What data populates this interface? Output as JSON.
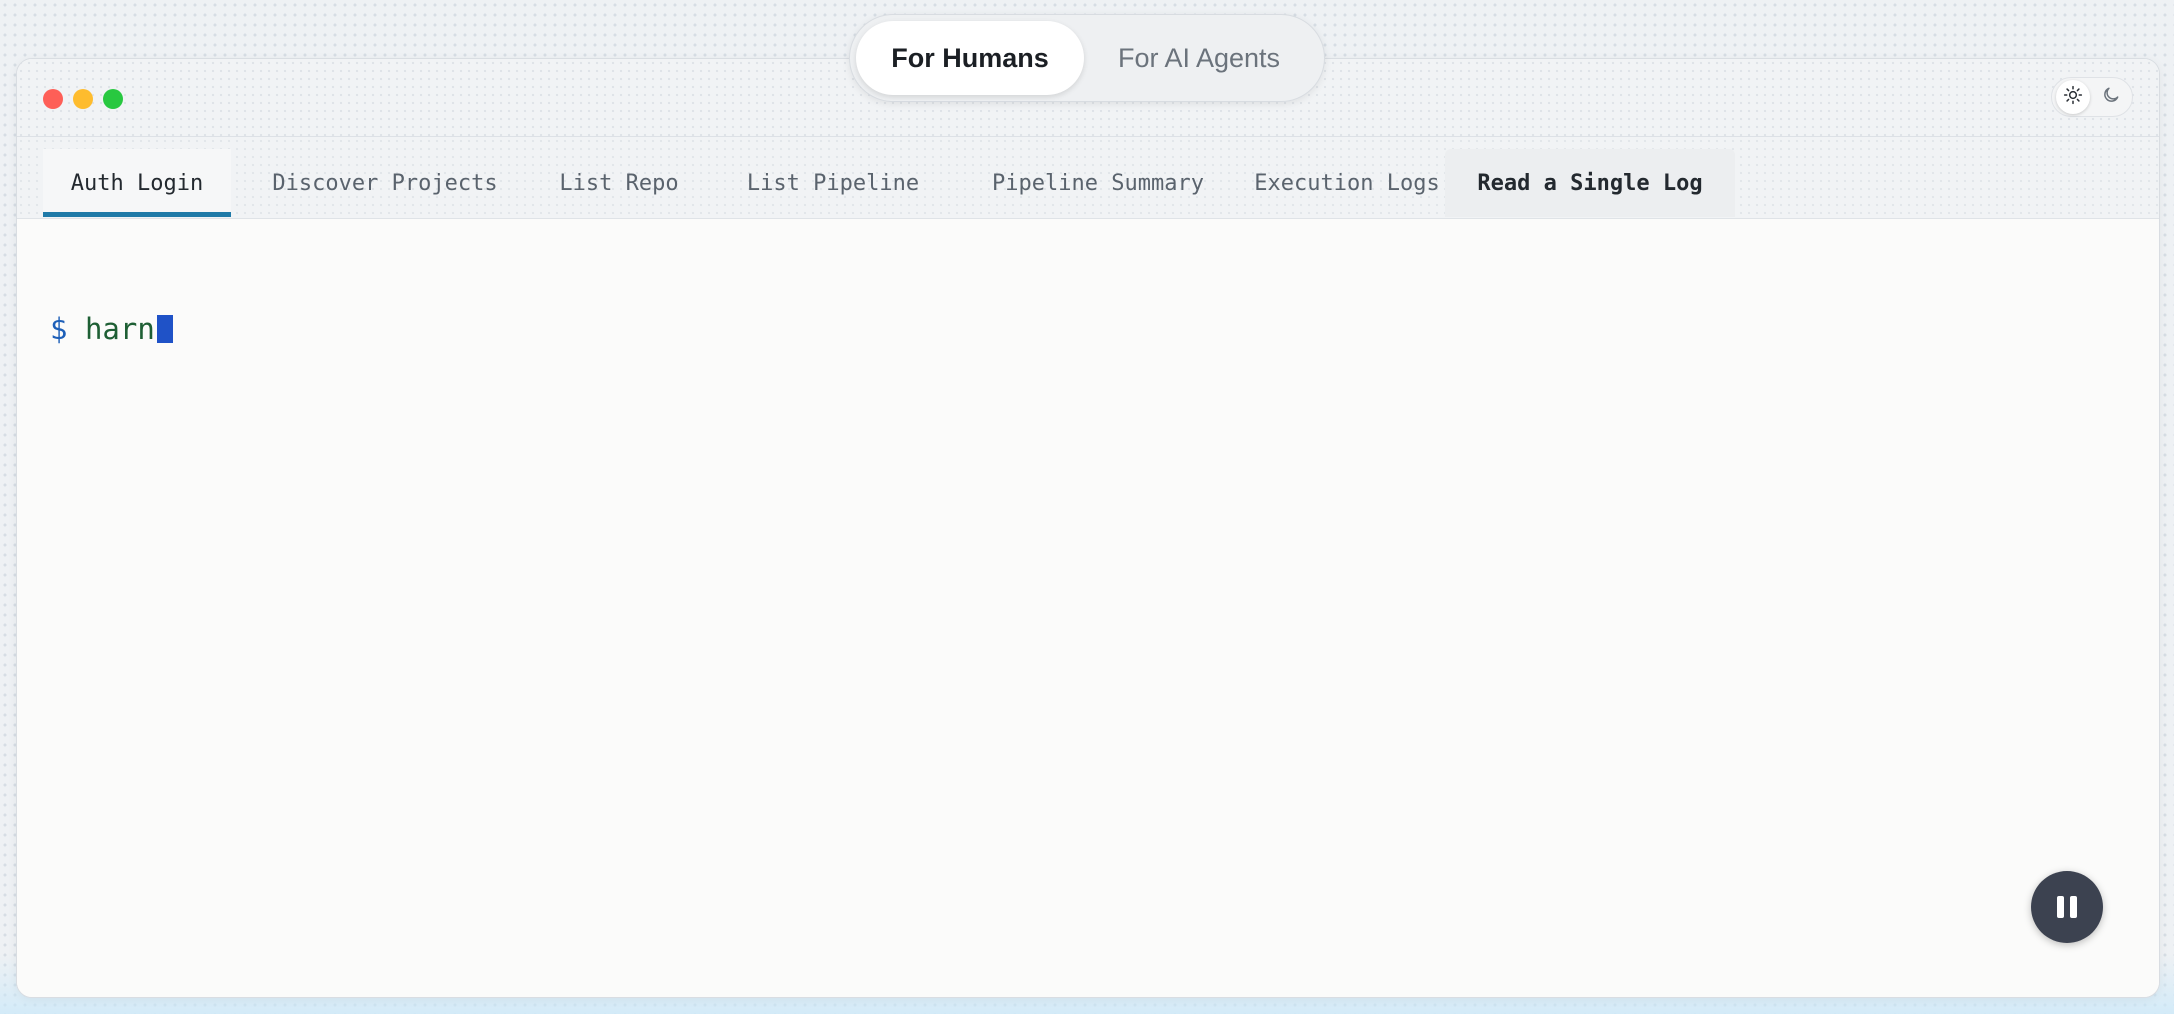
{
  "mode_switch": {
    "options": [
      {
        "label": "For Humans",
        "active": true
      },
      {
        "label": "For AI Agents",
        "active": false
      }
    ]
  },
  "window": {
    "traffic_lights": [
      "close",
      "minimize",
      "maximize"
    ],
    "theme_toggle": {
      "options": [
        "sun-icon",
        "moon-icon"
      ],
      "active": "sun-icon"
    }
  },
  "tabs": [
    {
      "label": "Auth Login",
      "active": true
    },
    {
      "label": "Discover Projects",
      "active": false
    },
    {
      "label": "List Repo",
      "active": false
    },
    {
      "label": "List Pipeline",
      "active": false
    },
    {
      "label": "Pipeline Summary",
      "active": false
    },
    {
      "label": "Execution Logs",
      "active": false
    },
    {
      "label": "Read a Single Log",
      "active": false,
      "hovered": true
    }
  ],
  "terminal": {
    "prompt": "$",
    "command": "harn"
  },
  "controls": {
    "playback": "pause-icon"
  },
  "colors": {
    "accent": "#1f7aa8",
    "prompt": "#1d5fb8",
    "command": "#1e5f34",
    "cursor": "#1f52c7",
    "pause_button": "#3c4250",
    "traffic_red": "#fe5f57",
    "traffic_yellow": "#febc2e",
    "traffic_green": "#28c840"
  }
}
